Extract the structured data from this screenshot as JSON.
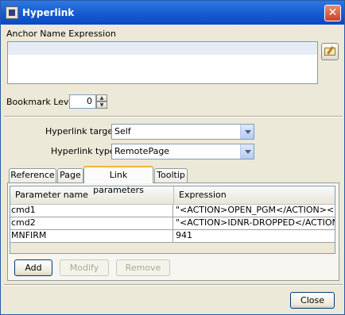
{
  "window": {
    "title": "Hyperlink"
  },
  "anchor": {
    "label": "Anchor Name Expression",
    "value": ""
  },
  "bookmark": {
    "label": "Bookmark Level",
    "value": "0"
  },
  "hyperlink_target": {
    "label": "Hyperlink target",
    "value": "Self"
  },
  "hyperlink_type": {
    "label": "Hyperlink type",
    "value": "RemotePage"
  },
  "tabs": [
    {
      "label": "Reference"
    },
    {
      "label": "Page"
    },
    {
      "label": "Link parameters"
    },
    {
      "label": "Tooltip"
    }
  ],
  "table": {
    "columns": [
      "Parameter name",
      "Expression"
    ],
    "rows": [
      {
        "name": "cmd1",
        "expression": "\"<ACTION>OPEN_PGM</ACTION><P..."
      },
      {
        "name": "cmd2",
        "expression": "\"<ACTION>IDNR-DROPPED</ACTION..."
      },
      {
        "name": "MNFIRM",
        "expression": "941"
      }
    ]
  },
  "buttons": {
    "add": "Add",
    "modify": "Modify",
    "remove": "Remove",
    "close": "Close"
  },
  "icons": {
    "app": "app-icon",
    "close": "close-icon",
    "edit": "edit-expression-icon"
  }
}
